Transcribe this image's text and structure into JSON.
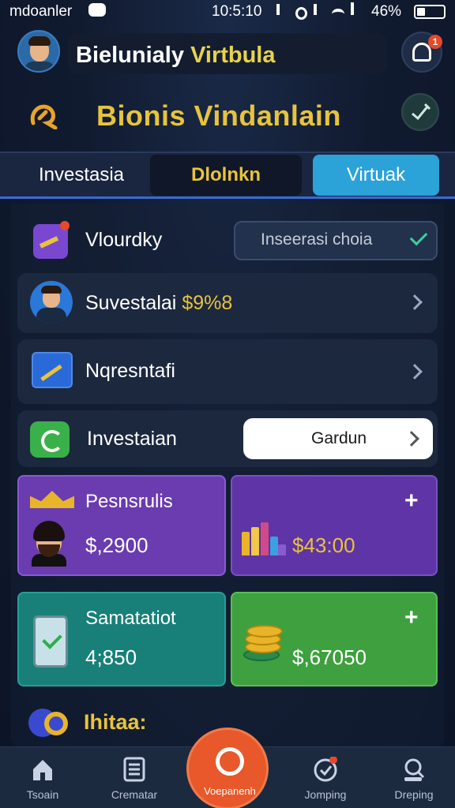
{
  "status_bar": {
    "carrier": "mdoanler",
    "time": "10:5:10",
    "battery": "46%"
  },
  "header": {
    "title_main": "Bielunialy",
    "title_accent": "Virtbula",
    "notification_count": "1"
  },
  "brand": {
    "title": "Bionis Vindanlain"
  },
  "tabs": [
    {
      "label": "Investasia"
    },
    {
      "label": "Dlolnkn"
    },
    {
      "label": "Virtuak"
    }
  ],
  "rows": {
    "vlourdky": {
      "label": "Vlourdky",
      "select_value": "Inseerasi choia"
    },
    "suvestalai": {
      "label": "Suvestalai",
      "amount": "$9%8"
    },
    "nqresntafi": {
      "label": "Nqresntafi"
    },
    "investaian": {
      "label": "Investaian",
      "button_label": "Gardun"
    }
  },
  "cards": [
    {
      "label": "Pesnsrulis",
      "value": "$,2900"
    },
    {
      "label": "",
      "value": "$43:00",
      "plus": "+"
    },
    {
      "label": "Samatatiot",
      "value": "4;850"
    },
    {
      "label": "",
      "value": "$,67050",
      "plus": "+"
    }
  ],
  "section": {
    "label": "Ihitaa:"
  },
  "bottom_nav": [
    {
      "label": "Tsoain",
      "icon": "home-icon"
    },
    {
      "label": "Crematar",
      "icon": "list-icon"
    },
    {
      "label": "Voepanenh",
      "icon": "search-icon"
    },
    {
      "label": "Jomping",
      "icon": "check-badge-icon"
    },
    {
      "label": "Dreping",
      "icon": "profile-search-icon"
    }
  ],
  "colors": {
    "accent_yellow": "#e8c33c",
    "tab_active": "#2ba2d8",
    "card_purple": "#6a3cb0",
    "card_teal": "#188078",
    "card_green": "#3ea03e",
    "nav_center": "#e8582a"
  }
}
